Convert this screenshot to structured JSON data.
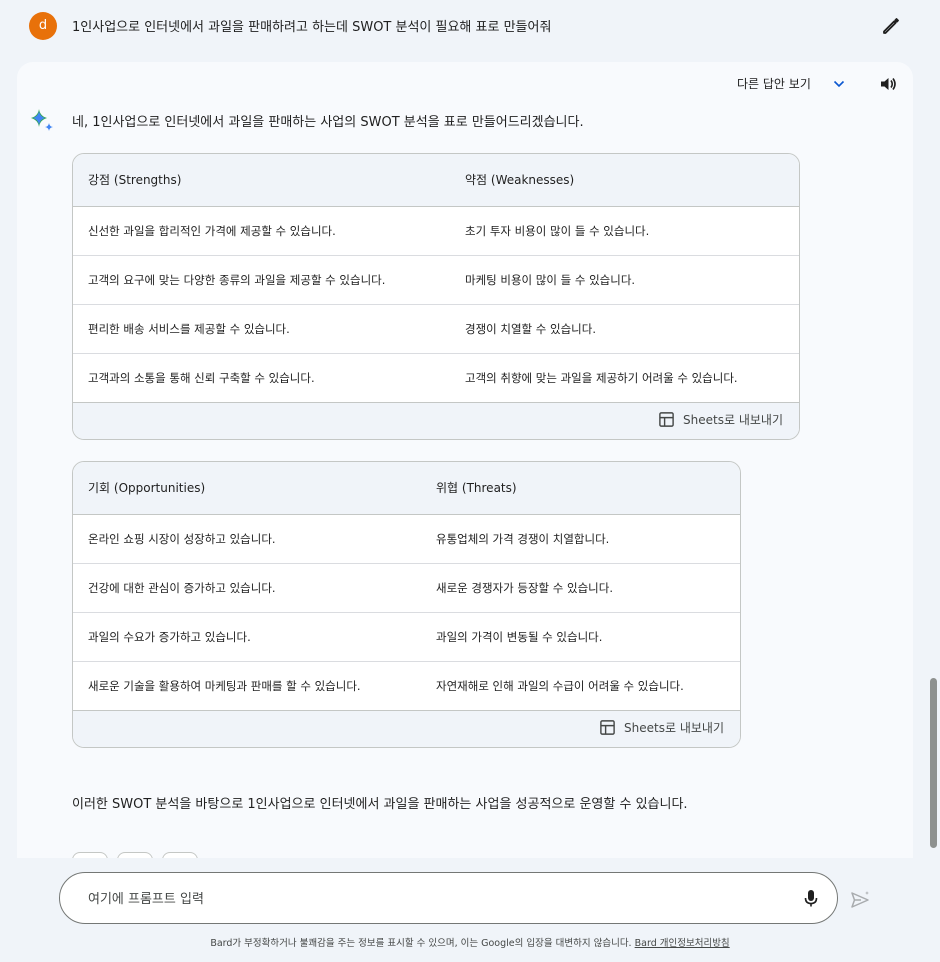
{
  "user": {
    "avatar_letter": "d",
    "prompt": "1인사업으로 인터넷에서 과일을 판매하려고 하는데  SWOT 분석이 필요해 표로 만들어줘"
  },
  "response": {
    "drafts_label": "다른 답안 보기",
    "intro": "네, 1인사업으로 인터넷에서 과일을 판매하는 사업의 SWOT 분석을 표로 만들어드리겠습니다.",
    "outro": "이러한 SWOT 분석을 바탕으로 1인사업으로 인터넷에서 과일을 판매하는 사업을 성공적으로 운영할 수 있습니다.",
    "table1": {
      "headers": [
        "강점 (Strengths)",
        "약점 (Weaknesses)"
      ],
      "rows": [
        [
          "신선한 과일을 합리적인 가격에 제공할 수 있습니다.",
          "초기 투자 비용이 많이 들 수 있습니다."
        ],
        [
          "고객의 요구에 맞는 다양한 종류의 과일을 제공할 수 있습니다.",
          "마케팅 비용이 많이 들 수 있습니다."
        ],
        [
          "편리한 배송 서비스를 제공할 수 있습니다.",
          "경쟁이 치열할 수 있습니다."
        ],
        [
          "고객과의 소통을 통해 신뢰 구축할 수 있습니다.",
          "고객의 취향에 맞는 과일을 제공하기 어려울 수 있습니다."
        ]
      ],
      "export_label": "Sheets로 내보내기"
    },
    "table2": {
      "headers": [
        "기회 (Opportunities)",
        "위협 (Threats)"
      ],
      "rows": [
        [
          "온라인 쇼핑 시장이 성장하고 있습니다.",
          "유통업체의 가격 경쟁이 치열합니다."
        ],
        [
          "건강에 대한 관심이 증가하고 있습니다.",
          "새로운 경쟁자가 등장할 수 있습니다."
        ],
        [
          "과일의 수요가 증가하고 있습니다.",
          "과일의 가격이 변동될 수 있습니다."
        ],
        [
          "새로운 기술을 활용하여 마케팅과 판매를 할 수 있습니다.",
          "자연재해로 인해 과일의 수급이 어려울 수 있습니다."
        ]
      ],
      "export_label": "Sheets로 내보내기"
    }
  },
  "input": {
    "placeholder": "여기에 프롬프트 입력"
  },
  "footer": {
    "disclaimer": "Bard가 부정확하거나 불쾌감을 주는 정보를 표시할 수 있으며, 이는 Google의 입장을 대변하지 않습니다.",
    "privacy_link": "Bard 개인정보처리방침"
  },
  "colors": {
    "avatar": "#e8710a",
    "background": "#f0f4f9",
    "sparkle_blue": "#4285f4",
    "sparkle_green": "#34a853"
  },
  "icons": [
    "edit-icon",
    "chevron-down-icon",
    "speaker-icon",
    "bard-sparkle-icon",
    "sheets-icon",
    "mic-icon",
    "send-icon"
  ]
}
